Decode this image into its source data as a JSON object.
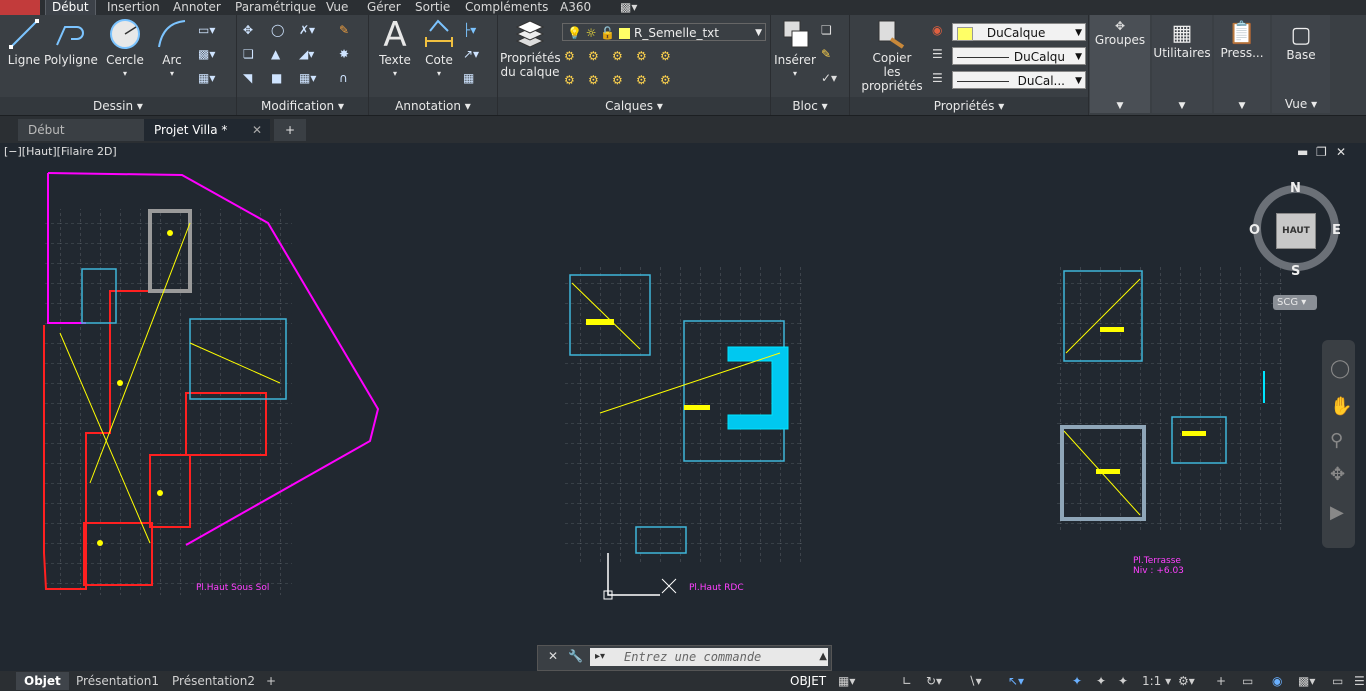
{
  "ribbon_tabs": [
    "Début",
    "Insertion",
    "Annoter",
    "Paramétrique",
    "Vue",
    "Gérer",
    "Sortie",
    "Compléments",
    "A360"
  ],
  "panels": {
    "dessin": {
      "title": "Dessin",
      "ligne": "Ligne",
      "polyligne": "Polyligne",
      "cercle": "Cercle",
      "arc": "Arc"
    },
    "modification": {
      "title": "Modification"
    },
    "annotation": {
      "title": "Annotation",
      "texte": "Texte",
      "cote": "Cote"
    },
    "calques": {
      "title": "Calques",
      "proprietes_l1": "Propriétés",
      "proprietes_l2": "du calque",
      "layer_current": "R_Semelle_txt"
    },
    "bloc": {
      "title": "Bloc",
      "inserer": "Insérer"
    },
    "proprietes": {
      "title": "Propriétés",
      "copier_l1": "Copier",
      "copier_l2": "les propriétés",
      "color": "DuCalque",
      "linetype": "DuCalqu",
      "lineweight": "DuCal..."
    },
    "groupes": {
      "label": "Groupes"
    },
    "utilitaires": {
      "label": "Utilitaires"
    },
    "presse": {
      "label": "Press..."
    },
    "base": {
      "label": "Base"
    },
    "vue": {
      "title": "Vue"
    }
  },
  "doc_tabs": [
    "Début",
    "Projet Villa *"
  ],
  "viewport": {
    "title": "[−][Haut][Filaire 2D]"
  },
  "viewcube": {
    "n": "N",
    "s": "S",
    "e": "E",
    "o": "O",
    "top": "HAUT",
    "scg": "SCG"
  },
  "drawings": {
    "plan1": "Pl.Haut Sous Sol",
    "plan2": "Pl.Haut RDC",
    "plan3_l1": "Pl.Terrasse",
    "plan3_l2": "Niv : +6.03"
  },
  "command": {
    "placeholder": "Entrez une commande"
  },
  "layout_tabs": [
    "Objet",
    "Présentation1",
    "Présentation2"
  ],
  "status": {
    "objet": "OBJET",
    "scale": "1:1"
  },
  "colors": {
    "accent_bylayer": "#ffff66",
    "magenta": "#ff00ff",
    "red": "#ff2020",
    "yellow": "#ffff00",
    "cyan": "#00e5ff"
  }
}
